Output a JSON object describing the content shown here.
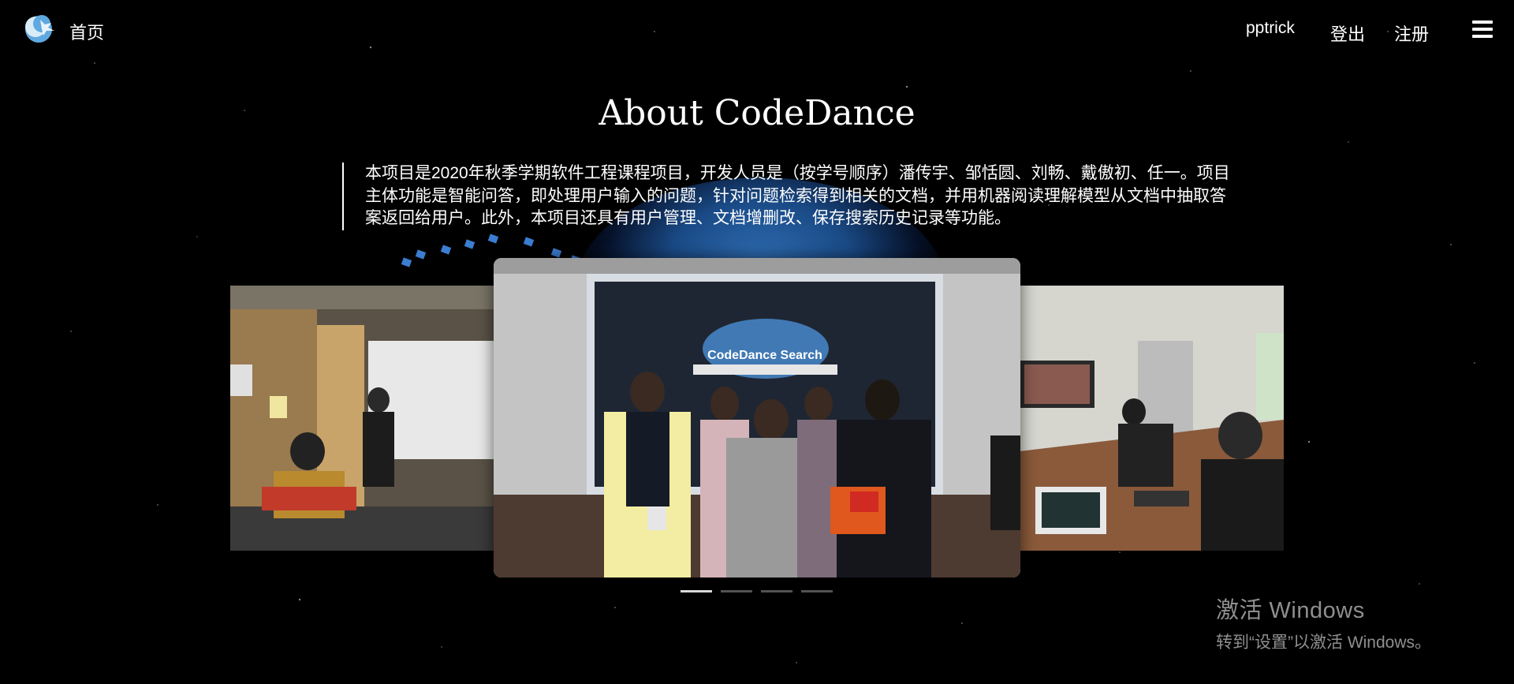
{
  "nav": {
    "home_label": "首页",
    "username": "pptrick",
    "logout_label": "登出",
    "register_label": "注册",
    "menu_icon": "hamburger-menu-icon",
    "logo_icon": "moon-logo-icon"
  },
  "about": {
    "title": "About CodeDance",
    "description": "本项目是2020年秋季学期软件工程课程项目，开发人员是（按学号顺序）潘传宇、邹恬圆、刘畅、戴傲初、任一。项目主体功能是智能问答，即处理用户输入的问题，针对问题检索得到相关的文档，并用机器阅读理解模型从文档中抽取答案返回给用户。此外，本项目还具有用户管理、文档增删改、保存搜索历史记录等功能。"
  },
  "carousel": {
    "center_screen_text": "CodeDance Search",
    "slide_count": 4,
    "active_index": 0
  },
  "watermark": {
    "title": "激活 Windows",
    "subtitle": "转到“设置”以激活 Windows。"
  },
  "colors": {
    "background": "#000000",
    "text": "#ffffff",
    "accent": "#2f6fb5"
  }
}
